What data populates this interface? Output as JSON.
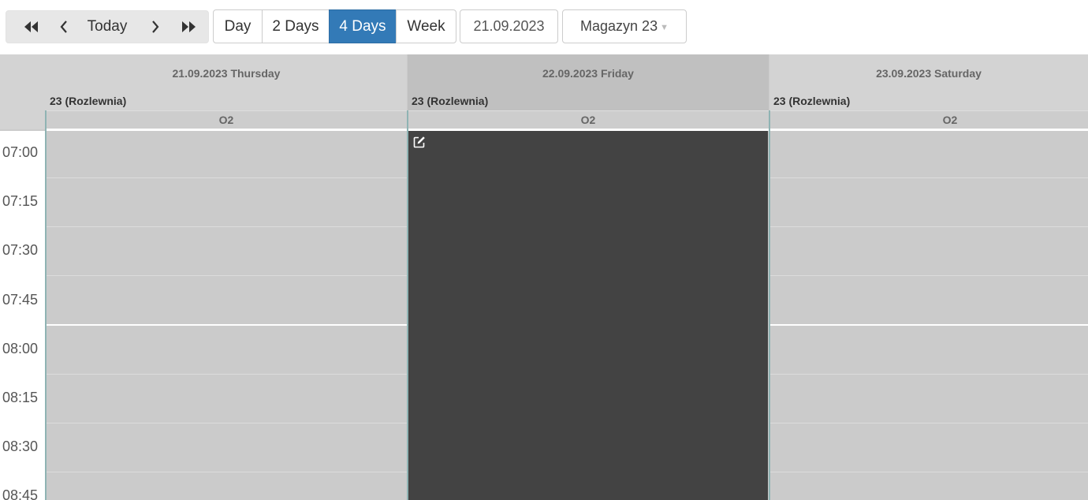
{
  "toolbar": {
    "nav": {
      "first_icon": "double-chevron-left-icon",
      "prev_icon": "chevron-left-icon",
      "today_label": "Today",
      "next_icon": "chevron-right-icon",
      "last_icon": "double-chevron-right-icon"
    },
    "views": [
      "Day",
      "2 Days",
      "4 Days",
      "Week"
    ],
    "active_view": "4 Days",
    "date_value": "21.09.2023",
    "warehouse_value": "Magazyn 23",
    "accent_color": "#337ab7"
  },
  "calendar": {
    "days": [
      {
        "date_label": "21.09.2023 Thursday",
        "resource": "23 (Rozlewnia)",
        "sub": "O2"
      },
      {
        "date_label": "22.09.2023 Friday",
        "resource": "23 (Rozlewnia)",
        "sub": "O2"
      },
      {
        "date_label": "23.09.2023 Saturday",
        "resource": "23 (Rozlewnia)",
        "sub": "O2"
      }
    ],
    "selected_day_index": 1,
    "times": [
      "07:00",
      "07:15",
      "07:30",
      "07:45",
      "08:00",
      "08:15",
      "08:30",
      "08:45"
    ],
    "blocked_event": {
      "icon": "edit-icon",
      "color": "#434343"
    }
  }
}
